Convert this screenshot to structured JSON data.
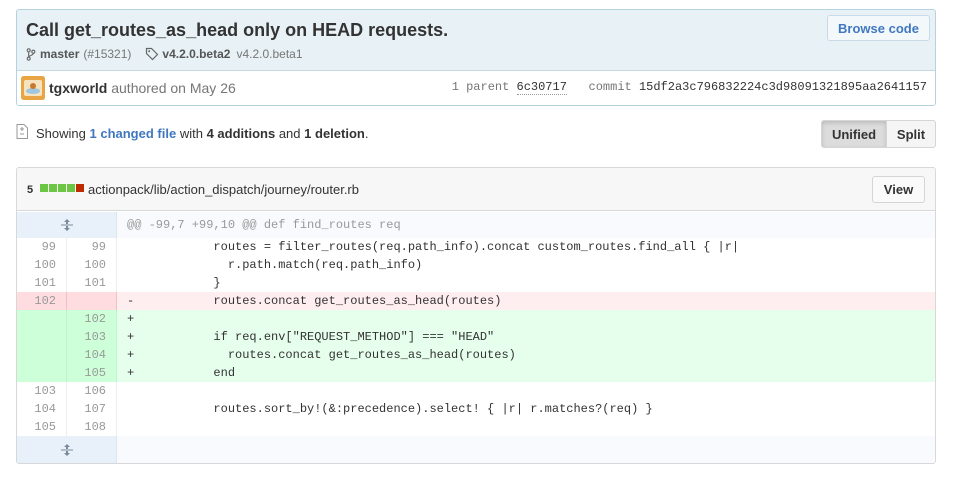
{
  "commit": {
    "title": "Call get_routes_as_head only on HEAD requests.",
    "browse_label": "Browse code",
    "branch": "master",
    "pr": "(#15321)",
    "tag_primary": "v4.2.0.beta2",
    "tag_secondary": "v4.2.0.beta1",
    "author": "tgxworld",
    "authored": "authored on May 26",
    "parent_label": "1 parent",
    "parent_sha": "6c30717",
    "commit_label": "commit",
    "commit_sha": "15df2a3c796832224c3d98091321895aa2641157"
  },
  "toc": {
    "showing": "Showing",
    "changed": "1 changed file",
    "with": "with",
    "additions": "4 additions",
    "and": "and",
    "deletions": "1 deletion",
    "period": "."
  },
  "view_toggle": {
    "unified": "Unified",
    "split": "Split"
  },
  "file": {
    "diffstat_count": "5",
    "diffstat_blocks": [
      "#6cc644",
      "#6cc644",
      "#6cc644",
      "#6cc644",
      "#bd2c00"
    ],
    "path": "actionpack/lib/action_dispatch/journey/router.rb",
    "view_label": "View",
    "hunk_header": "@@ -99,7 +99,10 @@ def find_routes req",
    "lines": [
      {
        "type": "ctx",
        "old": "99",
        "new": "99",
        "code": "            routes = filter_routes(req.path_info).concat custom_routes.find_all { |r|"
      },
      {
        "type": "ctx",
        "old": "100",
        "new": "100",
        "code": "              r.path.match(req.path_info)"
      },
      {
        "type": "ctx",
        "old": "101",
        "new": "101",
        "code": "            }"
      },
      {
        "type": "del",
        "old": "102",
        "new": "",
        "code": "-           routes.concat get_routes_as_head(routes)"
      },
      {
        "type": "add",
        "old": "",
        "new": "102",
        "code": "+"
      },
      {
        "type": "add",
        "old": "",
        "new": "103",
        "code": "+           if req.env[\"REQUEST_METHOD\"] === \"HEAD\""
      },
      {
        "type": "add",
        "old": "",
        "new": "104",
        "code": "+             routes.concat get_routes_as_head(routes)"
      },
      {
        "type": "add",
        "old": "",
        "new": "105",
        "code": "+           end"
      },
      {
        "type": "ctx",
        "old": "103",
        "new": "106",
        "code": ""
      },
      {
        "type": "ctx",
        "old": "104",
        "new": "107",
        "code": "            routes.sort_by!(&:precedence).select! { |r| r.matches?(req) }"
      },
      {
        "type": "ctx",
        "old": "105",
        "new": "108",
        "code": ""
      }
    ]
  },
  "colors": {
    "add_bg": "#e6ffed",
    "del_bg": "#ffeef0",
    "link": "#4078c0"
  }
}
